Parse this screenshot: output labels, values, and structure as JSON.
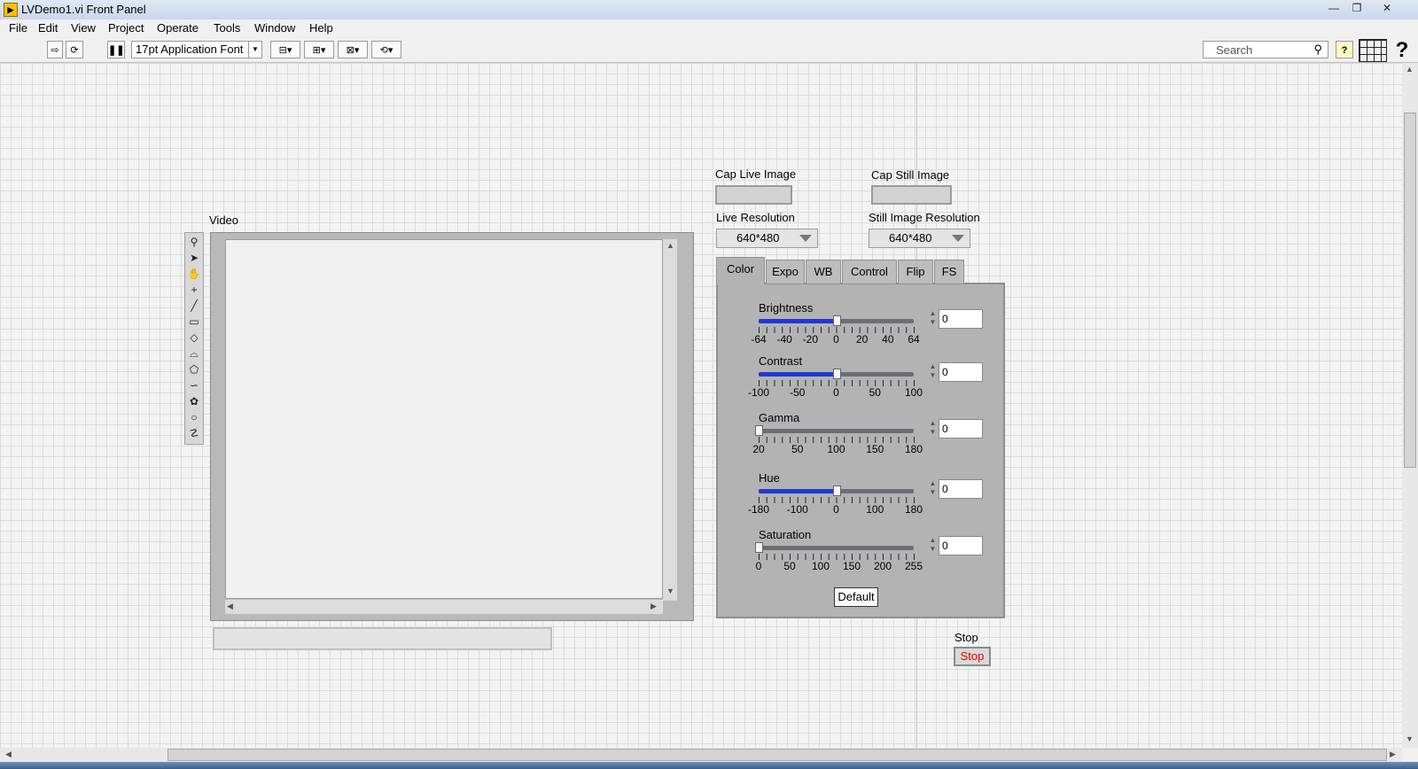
{
  "window": {
    "title": "LVDemo1.vi Front Panel",
    "icon": "labview-vi-icon",
    "controls": [
      "—",
      "❐",
      "✕"
    ]
  },
  "menu": [
    "File",
    "Edit",
    "View",
    "Project",
    "Operate",
    "Tools",
    "Window",
    "Help"
  ],
  "toolbar": {
    "font_label": "17pt Application Font",
    "search_placeholder": "Search",
    "help_glyph": "?"
  },
  "panel": {
    "video_label": "Video",
    "cap_live_label": "Cap Live Image",
    "cap_still_label": "Cap Still Image",
    "live_res_label": "Live Resolution",
    "live_res_value": "640*480",
    "still_res_label": "Still Image Resolution",
    "still_res_value": "640*480",
    "tabs": [
      "Color",
      "Expo",
      "WB",
      "Control",
      "Flip",
      "FS"
    ],
    "active_tab": "Color",
    "sliders": [
      {
        "name": "Brightness",
        "value": "0",
        "scale": [
          "-64",
          "-40",
          "-20",
          "0",
          "20",
          "40",
          "64"
        ],
        "fill": 0.5
      },
      {
        "name": "Contrast",
        "value": "0",
        "scale": [
          "-100",
          "-50",
          "0",
          "50",
          "100"
        ],
        "fill": 0.5
      },
      {
        "name": "Gamma",
        "value": "0",
        "scale": [
          "20",
          "50",
          "100",
          "150",
          "180"
        ],
        "fill": 0.0
      },
      {
        "name": "Hue",
        "value": "0",
        "scale": [
          "-180",
          "-100",
          "0",
          "100",
          "180"
        ],
        "fill": 0.5
      },
      {
        "name": "Saturation",
        "value": "0",
        "scale": [
          "0",
          "50",
          "100",
          "150",
          "200",
          "255"
        ],
        "fill": 0.0
      }
    ],
    "default_label": "Default",
    "stop_label": "Stop",
    "stop_button_label": "Stop"
  },
  "colors": {
    "slider_fill": "#1e3ad6",
    "stop_text": "#e00000"
  }
}
